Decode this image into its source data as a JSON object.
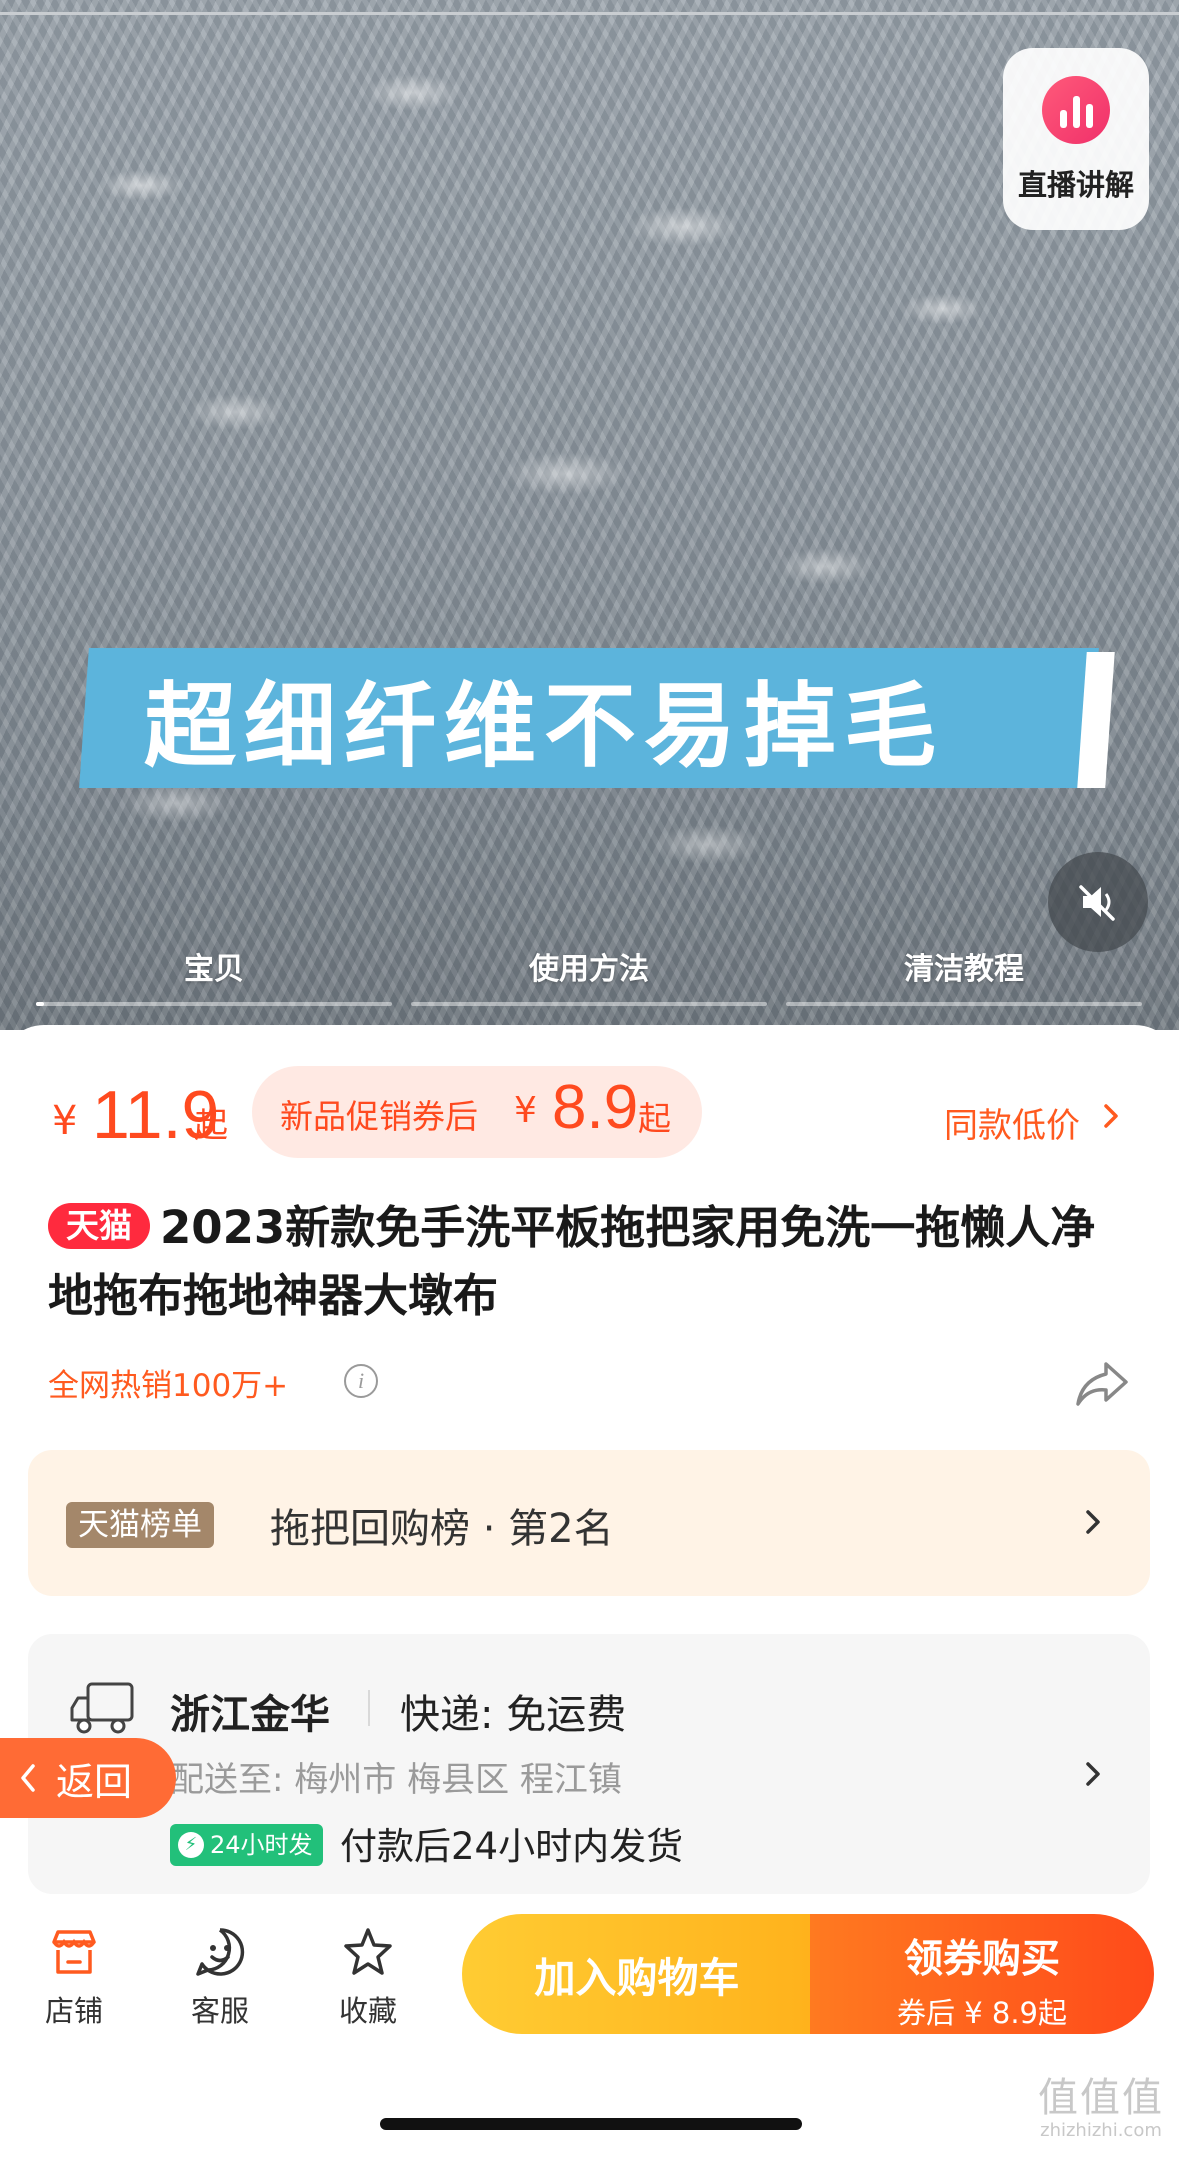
{
  "media": {
    "live_label": "直播讲解",
    "banner_text": "超细纤维不易掉毛",
    "tabs": [
      {
        "label": "宝贝",
        "progress": 0.02
      },
      {
        "label": "使用方法",
        "progress": 0
      },
      {
        "label": "清洁教程",
        "progress": 0
      }
    ],
    "icons": {
      "live": "live-stream-icon",
      "mute": "speaker-muted-icon"
    }
  },
  "price": {
    "yen": "¥",
    "value": "11.9",
    "suffix": "起",
    "promo_label": "新品促销券后",
    "promo_yen": "¥",
    "promo_value": "8.9",
    "promo_suffix": "起",
    "same_low": "同款低价"
  },
  "product": {
    "tag": "天猫",
    "title": "2023新款免手洗平板拖把家用免洗一拖懒人净地拖布拖地神器大墩布",
    "sales": "全网热销100万+"
  },
  "rank": {
    "tag": "天猫榜单",
    "text": "拖把回购榜 · 第2名"
  },
  "shipping": {
    "origin": "浙江金华",
    "express": "快递: 免运费",
    "destination": "配送至: 梅州市 梅县区 程江镇",
    "badge": "24小时发",
    "promise": "付款后24小时内发货"
  },
  "back_label": "返回",
  "bottom": {
    "store": "店铺",
    "service": "客服",
    "favorite": "收藏",
    "add_cart": "加入购物车",
    "buy": "领券购买",
    "buy_sub": "券后 ¥ 8.9起"
  },
  "watermark": {
    "big": "值值值",
    "small": "zhizhizhi.com"
  },
  "colors": {
    "accent": "#ff4a1f",
    "tmall_red": "#ff2a3e",
    "cart_yellow": "#ffb21c",
    "buy_orange": "#ff5a1a",
    "green": "#22c07a"
  }
}
